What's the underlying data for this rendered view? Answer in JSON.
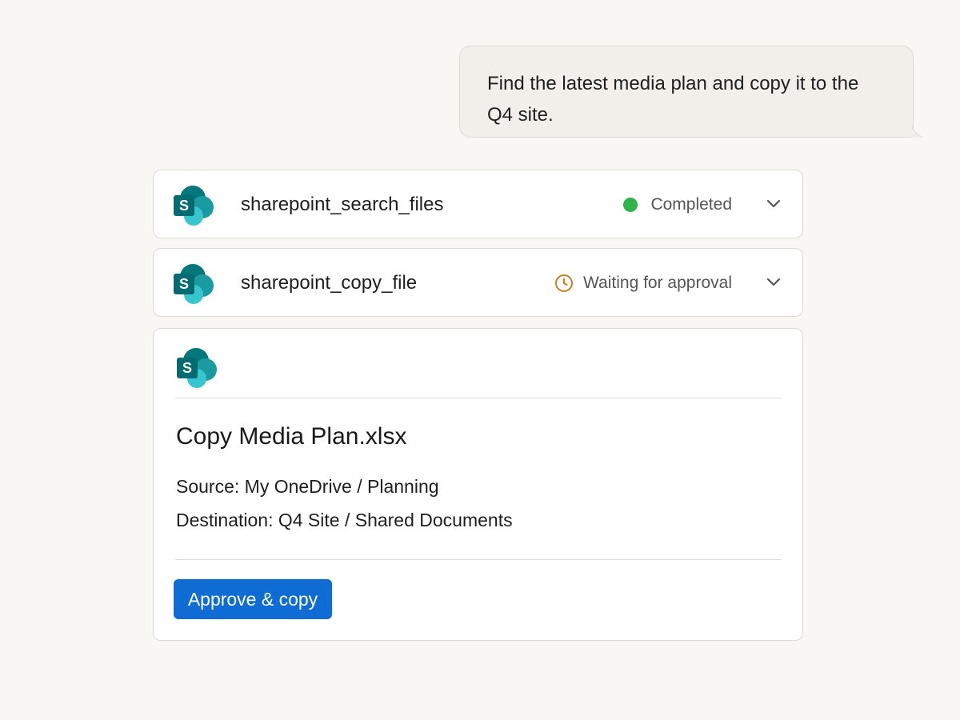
{
  "chat": {
    "user_message": "Find the latest media plan and copy it to the Q4 site."
  },
  "tool_calls": [
    {
      "name": "sharepoint_search_files",
      "status": "Completed",
      "status_icon": "green-dot",
      "status_color": "#2fb34a"
    },
    {
      "name": "sharepoint_copy_file",
      "status": "Waiting for approval",
      "status_icon": "clock-icon",
      "status_color": "#c9821a"
    }
  ],
  "approval": {
    "title": "Copy Media Plan.xlsx",
    "source": "Source: My OneDrive / Planning",
    "destination": "Destination: Q4 Site / Shared Documents",
    "approve_label": "Approve & copy"
  },
  "icons": {
    "app_logo": "sharepoint-logo",
    "expand": "chevron-down-icon"
  },
  "colors": {
    "primary_button": "#0f6cd4",
    "sharepoint_dark": "#03787c",
    "sharepoint_mid": "#1a9ba1",
    "sharepoint_light": "#37c6d0"
  }
}
